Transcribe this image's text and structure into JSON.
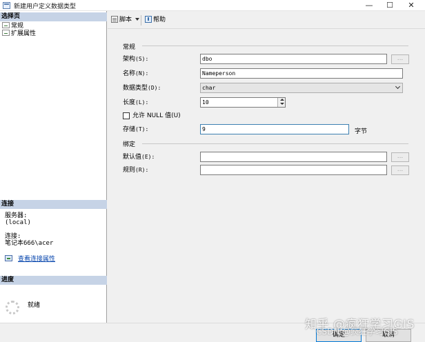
{
  "window": {
    "title": "新建用户定义数据类型",
    "minimize_glyph": "—",
    "maximize_glyph": "☐",
    "close_glyph": "✕"
  },
  "left_pane": {
    "select_page_header": "选择页",
    "pages": [
      {
        "label": "常规",
        "icon": "page-icon"
      },
      {
        "label": "扩展属性",
        "icon": "page-icon"
      }
    ],
    "connection_header": "连接",
    "server_label": "服务器:",
    "server_value": "(local)",
    "connection_label": "连接:",
    "connection_value": "笔记本666\\acer",
    "view_connection_link": "查看连接属性",
    "progress_header": "进度",
    "progress_status": "就绪"
  },
  "toolbar": {
    "script_label": "脚本",
    "help_label": "帮助"
  },
  "general": {
    "group_title": "常规",
    "schema_label": "架构",
    "schema_key": "(S):",
    "schema_value": "dbo",
    "name_label": "名称",
    "name_key": "(N):",
    "name_value": "Nameperson",
    "datatype_label": "数据类型",
    "datatype_key": "(D):",
    "datatype_value": "char",
    "length_label": "长度",
    "length_key": "(L):",
    "length_value": "10",
    "allow_null_label": "允许 NULL 值(U)",
    "allow_null_checked": false,
    "storage_label": "存储",
    "storage_key": "(T):",
    "storage_value": "9",
    "storage_unit": "字节",
    "browse_glyph": "..."
  },
  "binding": {
    "group_title": "绑定",
    "default_label": "默认值",
    "default_key": "(E):",
    "default_value": "",
    "rule_label": "规则",
    "rule_key": "(R):",
    "rule_value": ""
  },
  "buttons": {
    "ok": "确定",
    "cancel": "取消"
  },
  "watermark": {
    "line1": "知乎 @疯狂学习GIS",
    "line2": "CSDN @疯狂学习GIS"
  },
  "colors": {
    "section_header_bg": "#c6d3e6",
    "focus_border": "#3c7fb1",
    "link": "#0645ad"
  }
}
